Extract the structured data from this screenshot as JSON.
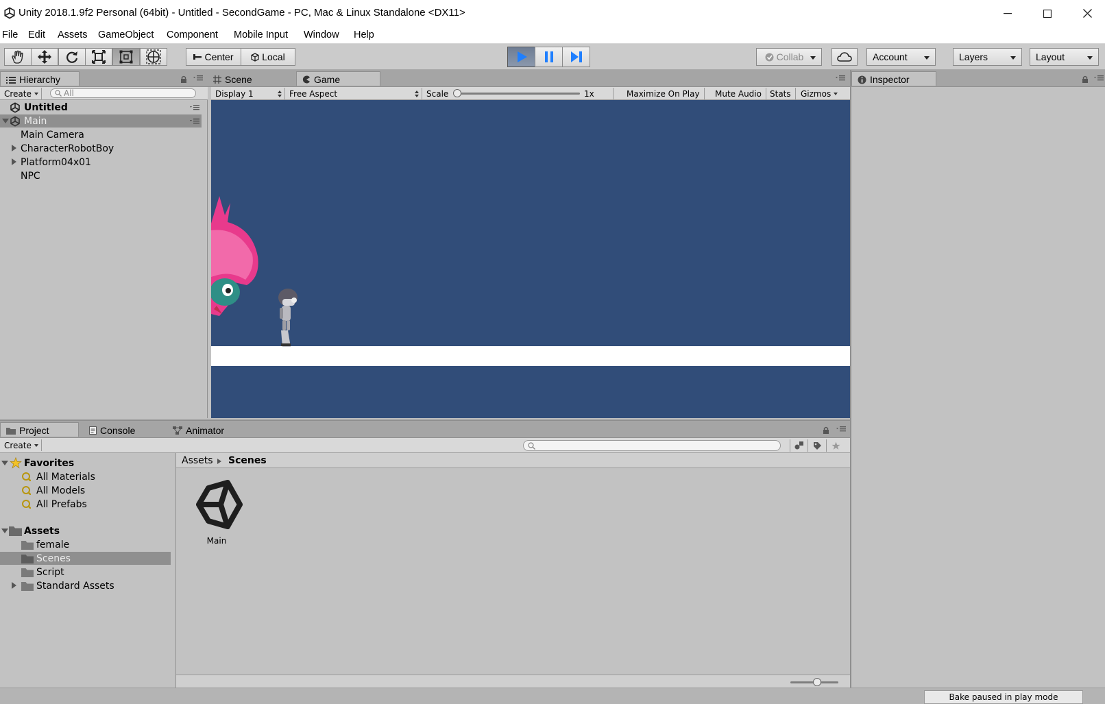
{
  "window": {
    "title": "Unity 2018.1.9f2 Personal (64bit) - Untitled - SecondGame - PC, Mac & Linux Standalone <DX11>"
  },
  "menu": [
    "File",
    "Edit",
    "Assets",
    "GameObject",
    "Component",
    "Mobile Input",
    "Window",
    "Help"
  ],
  "toolbar": {
    "tools": [
      "hand-tool",
      "move-tool",
      "rotate-tool",
      "scale-tool",
      "rect-tool",
      "transform-tool"
    ],
    "pivot_label": "Center",
    "space_label": "Local",
    "collab_label": "Collab",
    "account_label": "Account",
    "layers_label": "Layers",
    "layout_label": "Layout"
  },
  "hierarchy": {
    "tab_label": "Hierarchy",
    "create_label": "Create",
    "search_placeholder": "All",
    "scene_untitled": "Untitled",
    "scene_main": "Main",
    "items": [
      {
        "label": "Main Camera",
        "expandable": false
      },
      {
        "label": "CharacterRobotBoy",
        "expandable": true
      },
      {
        "label": "Platform04x01",
        "expandable": true
      },
      {
        "label": "NPC",
        "expandable": false
      }
    ]
  },
  "game_view": {
    "tabs": [
      {
        "label": "Scene"
      },
      {
        "label": "Game"
      }
    ],
    "display_label": "Display 1",
    "aspect_label": "Free Aspect",
    "scale_label": "Scale",
    "scale_value": "1x",
    "maximize_label": "Maximize On Play",
    "mute_label": "Mute Audio",
    "stats_label": "Stats",
    "gizmos_label": "Gizmos",
    "background_color": "#314d79",
    "platform_color": "#ffffff"
  },
  "inspector": {
    "tab_label": "Inspector"
  },
  "project": {
    "tabs": [
      {
        "label": "Project"
      },
      {
        "label": "Console"
      },
      {
        "label": "Animator"
      }
    ],
    "create_label": "Create",
    "favorites_label": "Favorites",
    "favorites": [
      "All Materials",
      "All Models",
      "All Prefabs"
    ],
    "assets_label": "Assets",
    "folders": [
      {
        "label": "female",
        "expandable": false,
        "selected": false
      },
      {
        "label": "Scenes",
        "expandable": false,
        "selected": true
      },
      {
        "label": "Script",
        "expandable": false,
        "selected": false
      },
      {
        "label": "Standard Assets",
        "expandable": true,
        "selected": false
      }
    ],
    "breadcrumb": [
      "Assets",
      "Scenes"
    ],
    "asset_items": [
      {
        "label": "Main"
      }
    ]
  },
  "status": {
    "bake_text": "Bake paused in play mode"
  }
}
